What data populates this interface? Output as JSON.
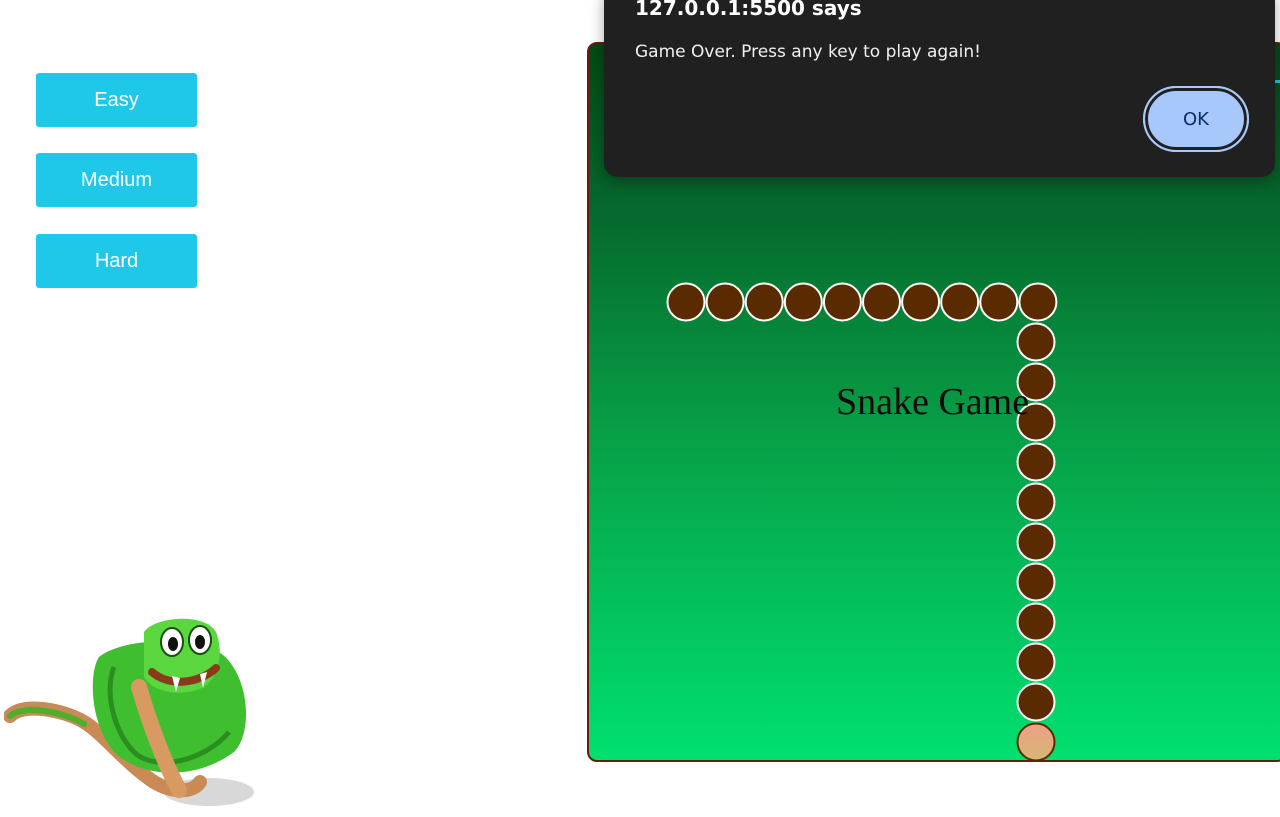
{
  "difficulty": {
    "easy_label": "Easy",
    "medium_label": "Medium",
    "hard_label": "Hard",
    "button_color": "#1fc8e8"
  },
  "game": {
    "title": "Snake Game",
    "snake_body_color": "#5a2a00",
    "snake_head_color": "#f0a08a",
    "snake_length": 21
  },
  "dialog": {
    "title": "127.0.0.1:5500 says",
    "message": "Game Over. Press any key to play again!",
    "ok_label": "OK"
  },
  "mascot": {
    "icon": "cartoon-snake-icon"
  }
}
